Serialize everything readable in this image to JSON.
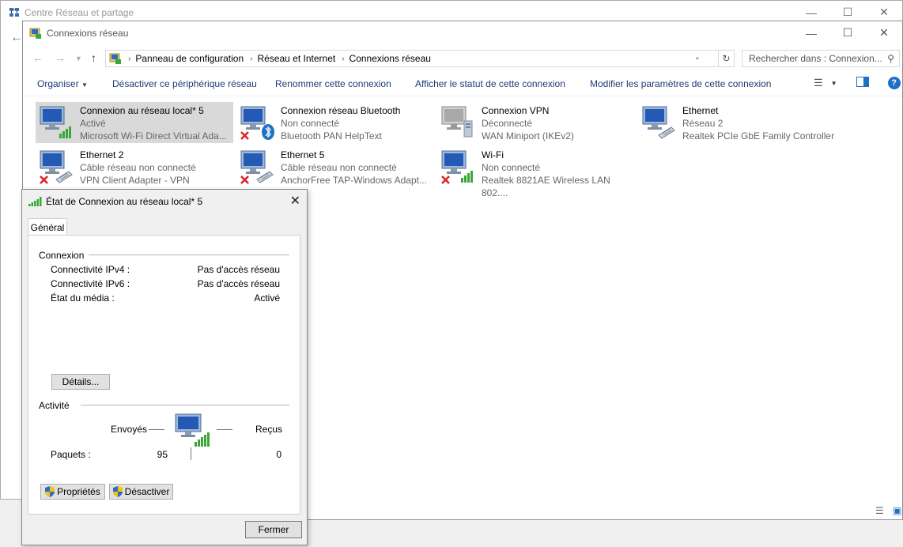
{
  "background_window": {
    "title": "Centre Réseau et partage"
  },
  "window": {
    "title": "Connexions réseau",
    "breadcrumbs": [
      "Panneau de configuration",
      "Réseau et Internet",
      "Connexions réseau"
    ],
    "search_placeholder": "Rechercher dans : Connexion..."
  },
  "toolbar": {
    "organize": "Organiser",
    "disable": "Désactiver ce périphérique réseau",
    "rename": "Renommer cette connexion",
    "status": "Afficher le statut de cette connexion",
    "settings": "Modifier les paramètres de cette connexion"
  },
  "connections": [
    {
      "name": "Connexion au réseau local* 5",
      "status": "Activé",
      "device": "Microsoft Wi-Fi Direct Virtual Ada...",
      "type": "wifi",
      "error": false,
      "selected": true
    },
    {
      "name": "Connexion réseau Bluetooth",
      "status": "Non connecté",
      "device": "Bluetooth PAN HelpText",
      "type": "bluetooth",
      "error": true,
      "selected": false
    },
    {
      "name": "Connexion VPN",
      "status": "Déconnecté",
      "device": "WAN Miniport (IKEv2)",
      "type": "vpn",
      "error": false,
      "selected": false
    },
    {
      "name": "Ethernet",
      "status": "Réseau 2",
      "device": "Realtek PCIe GbE Family Controller",
      "type": "ethernet",
      "error": false,
      "selected": false
    },
    {
      "name": "Ethernet 2",
      "status": "Câble réseau non connecté",
      "device": "VPN Client Adapter - VPN",
      "type": "ethernet",
      "error": true,
      "selected": false
    },
    {
      "name": "Ethernet 5",
      "status": "Câble réseau non connecté",
      "device": "AnchorFree TAP-Windows Adapt...",
      "type": "ethernet",
      "error": true,
      "selected": false
    },
    {
      "name": "Wi-Fi",
      "status": "Non connecté",
      "device": "Realtek 8821AE Wireless LAN 802....",
      "type": "wifi",
      "error": true,
      "selected": false
    }
  ],
  "dialog": {
    "title": "État de Connexion au réseau local* 5",
    "tab": "Général",
    "connection_group": "Connexion",
    "rows": [
      {
        "label": "Connectivité IPv4 :",
        "value": "Pas d'accès réseau"
      },
      {
        "label": "Connectivité IPv6 :",
        "value": "Pas d'accès réseau"
      },
      {
        "label": "État du média :",
        "value": "Activé"
      }
    ],
    "details_button": "Détails...",
    "activity_group": "Activité",
    "sent_label": "Envoyés",
    "received_label": "Reçus",
    "packets_label": "Paquets :",
    "packets_sent": "95",
    "packets_received": "0",
    "properties_button": "Propriétés",
    "disable_button": "Désactiver",
    "close_button": "Fermer"
  },
  "colors": {
    "accent_text": "#1e3d73",
    "selected_bg": "#d9d9d9",
    "error_red": "#d9262b",
    "signal_green": "#3aa839"
  }
}
